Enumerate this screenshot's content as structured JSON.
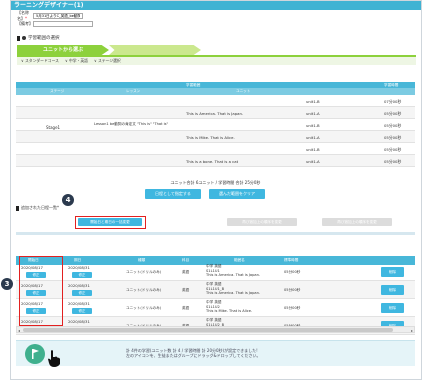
{
  "window": {
    "title": "ラーニングデザイナー(1)"
  },
  "form": {
    "name_label": "【名称名】",
    "name_required": "*",
    "name_value": "5月31日よりC_英語_be動詞",
    "memo_label": "【備考】",
    "memo_value": ""
  },
  "section1": {
    "title": "学習範囲の選択"
  },
  "tabs": {
    "unit_select": "ユニットから選ぶ",
    "second": ""
  },
  "breadcrumb": {
    "course": "スタンダードコース",
    "subject": "中学・英語",
    "stage": "ステージ選択"
  },
  "unit_table": {
    "header_top": "学習範囲",
    "header_time": "学習時間",
    "col_stage": "ステージ",
    "col_lesson": "レッスン",
    "col_unit": "ユニット",
    "stage": "Stage1",
    "lesson": "Lesson1 be動詞の肯定文 \"This is\" \"That is\"",
    "rows": [
      {
        "text": "",
        "unit": "unit1-B",
        "time": "07分00秒"
      },
      {
        "text": "This is America. That is Japan.",
        "unit": "unit1-A",
        "time": "05分00秒"
      },
      {
        "text": "",
        "unit": "unit1-B",
        "time": "05分00秒"
      },
      {
        "text": "This is Mike. That is Alice.",
        "unit": "unit1-A",
        "time": "05分00秒"
      },
      {
        "text": "",
        "unit": "unit1-B",
        "time": "05分00秒"
      },
      {
        "text": "This is a bone. That is a cat",
        "unit": "unit1-A",
        "time": "05分00秒"
      }
    ]
  },
  "summary": {
    "text": "ユニット合計 6ユニット / 学習時間 合計 25分0秒"
  },
  "buttons": {
    "add_dates": "日程として指定する",
    "clear_all": "選んだ範囲をクリア"
  },
  "section2": {
    "title": "追加された日程一覧*"
  },
  "list_toolbar": {
    "bulk_date": "開始日と期日の一括変更",
    "disabled1": "再び追加上の順序を変更",
    "disabled2": "再び追加上の順序を変更"
  },
  "list_table": {
    "headers": [
      "開始日",
      "期日",
      "種類",
      "科目",
      "範囲名",
      "標準時間",
      ""
    ],
    "rows": [
      {
        "start": "2020/08/17",
        "end": "2020/08/31",
        "type": "ユニット(ドリルのみ)",
        "subject": "英語",
        "title1": "中学 英語",
        "title2": "S1L1U1",
        "title3": "This is America. That is Japan.",
        "time": "05分00秒"
      },
      {
        "start": "2020/08/17",
        "end": "2020/08/31",
        "type": "ユニット(ドリルのみ)",
        "subject": "英語",
        "title1": "中学 英語",
        "title2": "S1L1U1_B",
        "title3": "This is America. That is Japan.",
        "time": "05分00秒"
      },
      {
        "start": "2020/08/17",
        "end": "2020/08/31",
        "type": "ユニット(ドリルのみ)",
        "subject": "英語",
        "title1": "中学 英語",
        "title2": "S1L1U2",
        "title3": "This is Mike. That is Alice.",
        "time": "05分00秒"
      },
      {
        "start": "2020/08/17",
        "end": "2020/08/31",
        "type": "ユニット(ドリルのみ)",
        "subject": "英語",
        "title1": "中学 英語",
        "title2": "S1L1U2_B",
        "title3": "This is Mike. That is Alice.",
        "time": "05分00秒"
      }
    ],
    "change_label": "修正",
    "delete_label": "削除"
  },
  "footer": {
    "line1": "計 4件の学習(ユニット数 計 4 / 学習時間 計 20分0秒)が設定できました!",
    "line2": "左のアイコンを、生徒またはグループにドラッグ&ドロップしてください。"
  },
  "annotations": {
    "badge3": "3",
    "badge4": "4"
  },
  "colors": {
    "accent": "#3fb7e0",
    "header": "#48b7d8",
    "tab": "#8dd13c",
    "highlight": "#e22020"
  }
}
